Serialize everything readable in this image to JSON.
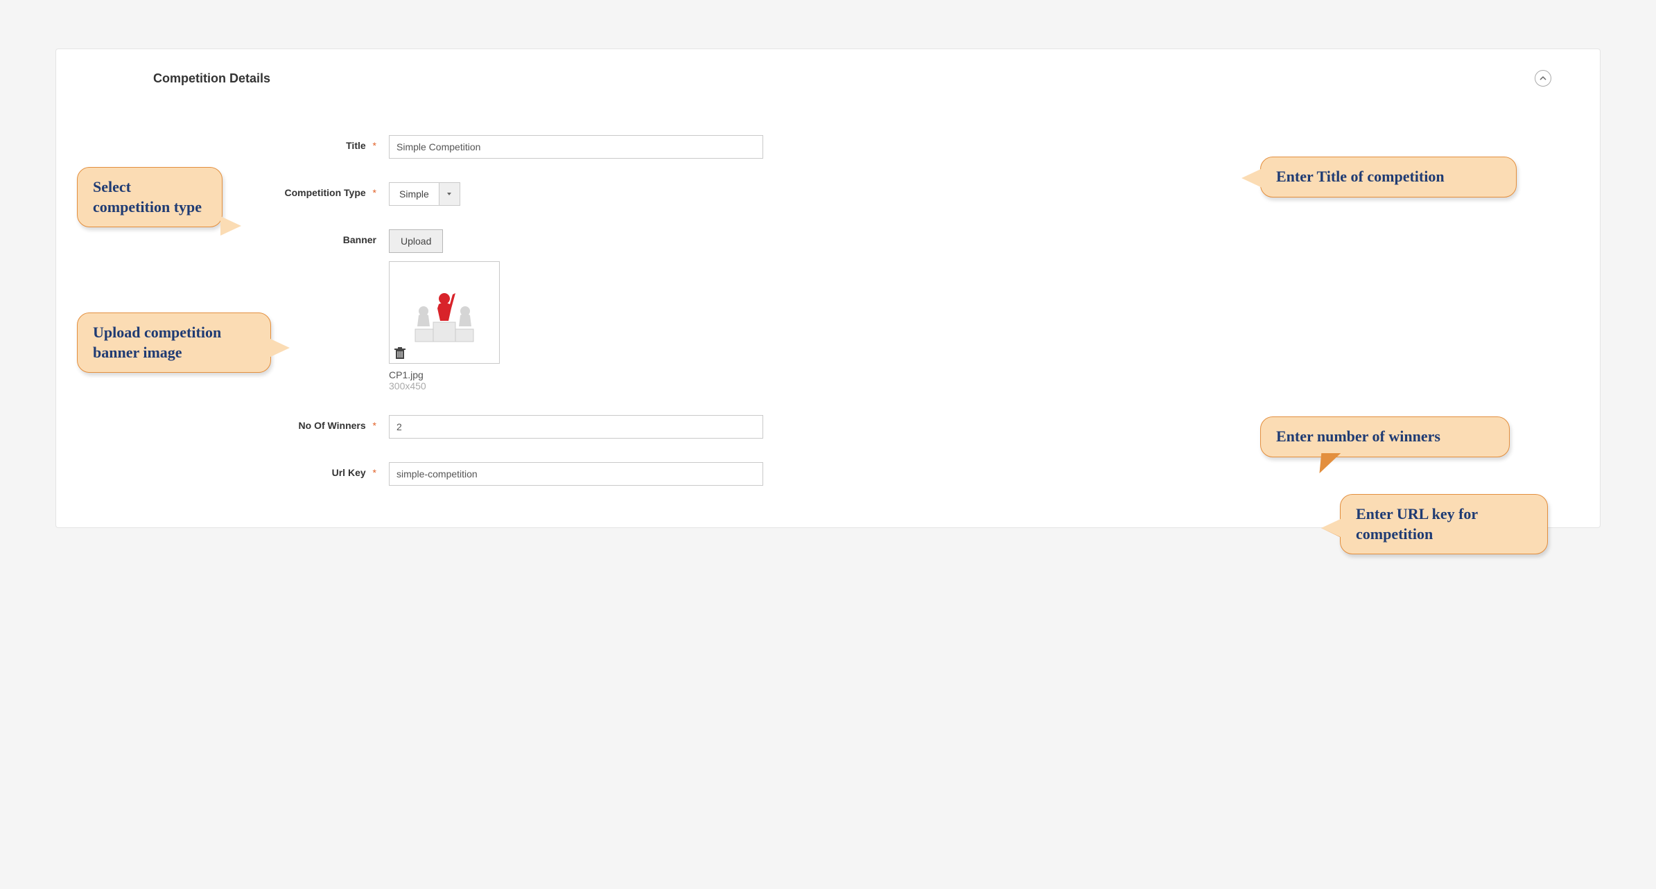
{
  "panel": {
    "title": "Competition Details"
  },
  "fields": {
    "title": {
      "label": "Title",
      "value": "Simple Competition"
    },
    "type": {
      "label": "Competition Type",
      "value": "Simple"
    },
    "banner": {
      "label": "Banner",
      "upload_btn": "Upload",
      "file_name": "CP1.jpg",
      "dimensions": "300x450"
    },
    "winners": {
      "label": "No Of Winners",
      "value": "2"
    },
    "urlkey": {
      "label": "Url Key",
      "value": "simple-competition"
    }
  },
  "callouts": {
    "select_type": "Select competition type",
    "upload_banner": "Upload competition banner image",
    "title": "Enter Title of competition",
    "winners": "Enter number of winners",
    "urlkey": "Enter URL key for competition"
  },
  "req_marker": "*"
}
